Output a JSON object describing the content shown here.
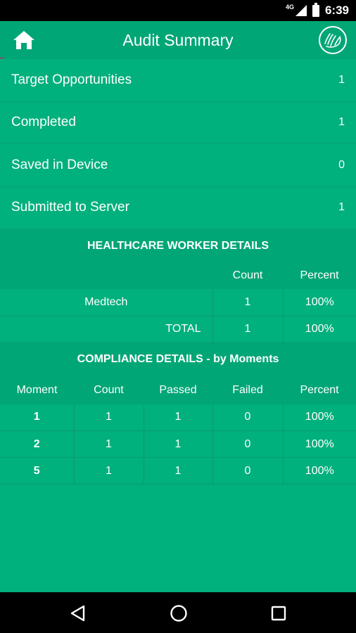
{
  "status_bar": {
    "network": "4G",
    "time": "6:39",
    "icons": [
      "signal-icon",
      "battery-icon"
    ]
  },
  "app_bar": {
    "title": "Audit Summary",
    "left_icon": "home-icon",
    "right_icon": "hand-hygiene-logo-icon"
  },
  "summary": [
    {
      "label": "Target Opportunities",
      "value": "1"
    },
    {
      "label": "Completed",
      "value": "1"
    },
    {
      "label": "Saved in Device",
      "value": "0"
    },
    {
      "label": "Submitted to Server",
      "value": "1"
    }
  ],
  "healthcare_workers": {
    "title": "HEALTHCARE WORKER DETAILS",
    "headers": {
      "count": "Count",
      "percent": "Percent"
    },
    "rows": [
      {
        "name": "Medtech",
        "count": "1",
        "percent": "100%"
      }
    ],
    "total": {
      "label": "TOTAL",
      "count": "1",
      "percent": "100%"
    }
  },
  "compliance": {
    "title": "COMPLIANCE DETAILS - by Moments",
    "headers": [
      "Moment",
      "Count",
      "Passed",
      "Failed",
      "Percent"
    ],
    "rows": [
      [
        "1",
        "1",
        "1",
        "0",
        "100%"
      ],
      [
        "2",
        "1",
        "1",
        "0",
        "100%"
      ],
      [
        "5",
        "1",
        "1",
        "0",
        "100%"
      ]
    ]
  },
  "nav_bar": {
    "icons": [
      "back-icon",
      "home-circle-icon",
      "recents-icon"
    ]
  },
  "colors": {
    "background": "#00b07d",
    "header": "#00a676",
    "divider": "#0b9a6c"
  }
}
